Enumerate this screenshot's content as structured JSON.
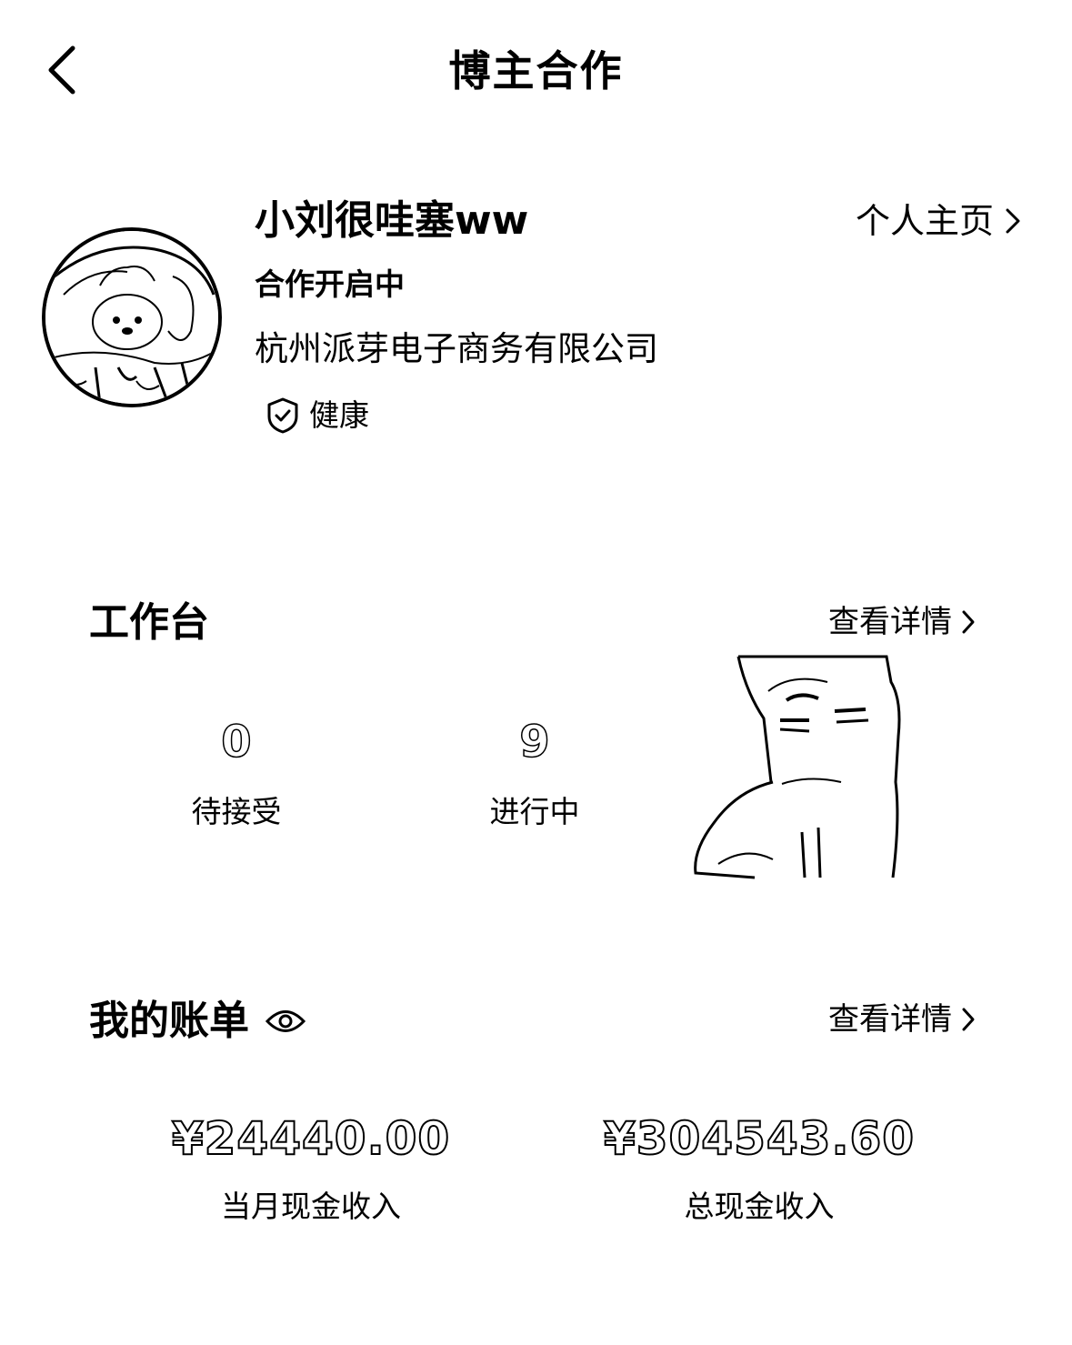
{
  "header": {
    "title": "博主合作",
    "back_icon": "chevron-left-icon"
  },
  "profile": {
    "username": "小刘很哇塞ww",
    "homepage_link": "个人主页",
    "coop_status": "合作开启中",
    "company": "杭州派芽电子商务有限公司",
    "health_label": "健康",
    "health_icon": "shield-check-icon"
  },
  "workbench": {
    "title": "工作台",
    "detail_link": "查看详情",
    "stats": [
      {
        "value": "0",
        "label": "待接受"
      },
      {
        "value": "9",
        "label": "进行中"
      }
    ]
  },
  "bills": {
    "title": "我的账单",
    "eye_icon": "eye-icon",
    "detail_link": "查看详情",
    "items": [
      {
        "value": "¥24440.00",
        "label": "当月现金收入"
      },
      {
        "value": "¥304543.60",
        "label": "总现金收入"
      }
    ]
  }
}
